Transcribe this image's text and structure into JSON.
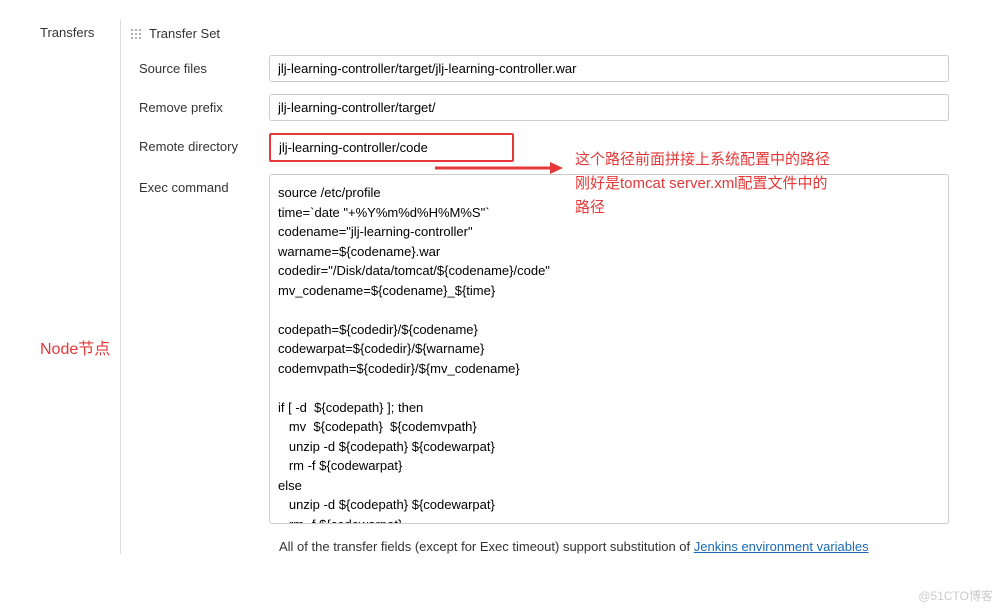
{
  "sidebar": {
    "transfers_label": "Transfers",
    "node_annotation": "Node节点"
  },
  "transfer_set": {
    "header": "Transfer Set",
    "source_files": {
      "label": "Source files",
      "value": "jlj-learning-controller/target/jlj-learning-controller.war"
    },
    "remove_prefix": {
      "label": "Remove prefix",
      "value": "jlj-learning-controller/target/"
    },
    "remote_directory": {
      "label": "Remote directory",
      "value": "jlj-learning-controller/code"
    },
    "exec_command": {
      "label": "Exec command",
      "value": "source /etc/profile\ntime=`date \"+%Y%m%d%H%M%S\"`\ncodename=\"jlj-learning-controller\"\nwarname=${codename}.war\ncodedir=\"/Disk/data/tomcat/${codename}/code\"\nmv_codename=${codename}_${time}\n\ncodepath=${codedir}/${codename}\ncodewarpat=${codedir}/${warname}\ncodemvpath=${codedir}/${mv_codename}\n\nif [ -d  ${codepath} ]; then\n   mv  ${codepath}  ${codemvpath}\n   unzip -d ${codepath} ${codewarpat}\n   rm -f ${codewarpat}\nelse\n   unzip -d ${codepath} ${codewarpat}\n   rm -f ${codewarpat}\nfi"
    }
  },
  "annotations": {
    "red_text_line1": "这个路径前面拼接上系统配置中的路径",
    "red_text_line2": "刚好是tomcat server.xml配置文件中的",
    "red_text_line3": "路径"
  },
  "footer": {
    "text_prefix": "All of the transfer fields (except for Exec timeout) support substitution of ",
    "link_text": "Jenkins environment variables"
  },
  "watermark": "@51CTO博客"
}
